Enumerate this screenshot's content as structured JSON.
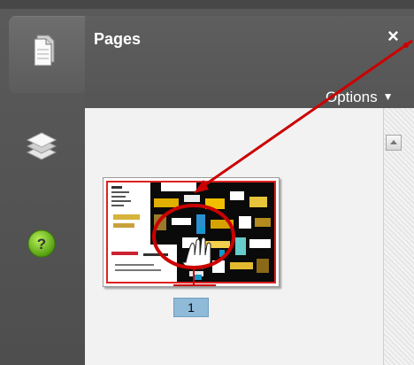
{
  "panel": {
    "title": "Pages",
    "close_glyph": "×",
    "options_label": "Options",
    "options_caret": "▼"
  },
  "rail": {
    "tabs": [
      {
        "icon": "pages-icon",
        "active": true
      },
      {
        "icon": "layers-icon",
        "active": false
      },
      {
        "icon": "help-icon",
        "active": false
      }
    ],
    "help_glyph": "?"
  },
  "thumbnails": [
    {
      "page_number": "1",
      "selected": true
    }
  ],
  "annotation": {
    "color": "#cc0000"
  },
  "colors": {
    "panel_header": "#5a5a5a",
    "thumbnail_area": "#f2f2f2",
    "page_number_badge": "#8fbad8",
    "help_green": "#7dc21e"
  }
}
